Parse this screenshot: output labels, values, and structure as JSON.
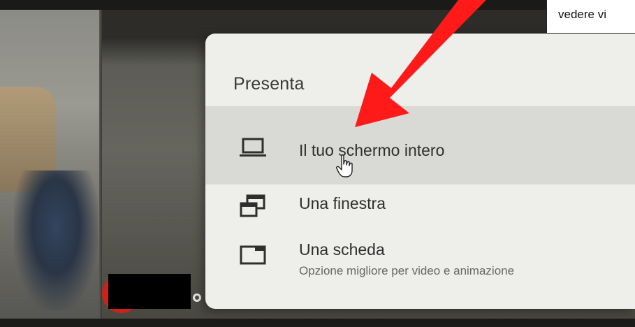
{
  "caption": {
    "text": "vedere vi"
  },
  "menu": {
    "title": "Presenta",
    "items": [
      {
        "label": "Il tuo schermo intero",
        "icon": "laptop-icon",
        "highlighted": true
      },
      {
        "label": "Una finestra",
        "icon": "window-icon",
        "highlighted": false
      },
      {
        "label": "Una scheda",
        "sublabel": "Opzione migliore per video e animazione",
        "icon": "tab-icon",
        "highlighted": false
      }
    ]
  },
  "colors": {
    "arrow": "#ff1a1a",
    "menu_bg": "#eeeeea",
    "highlight_bg": "#d9d9d5",
    "redaction": "#000000"
  }
}
